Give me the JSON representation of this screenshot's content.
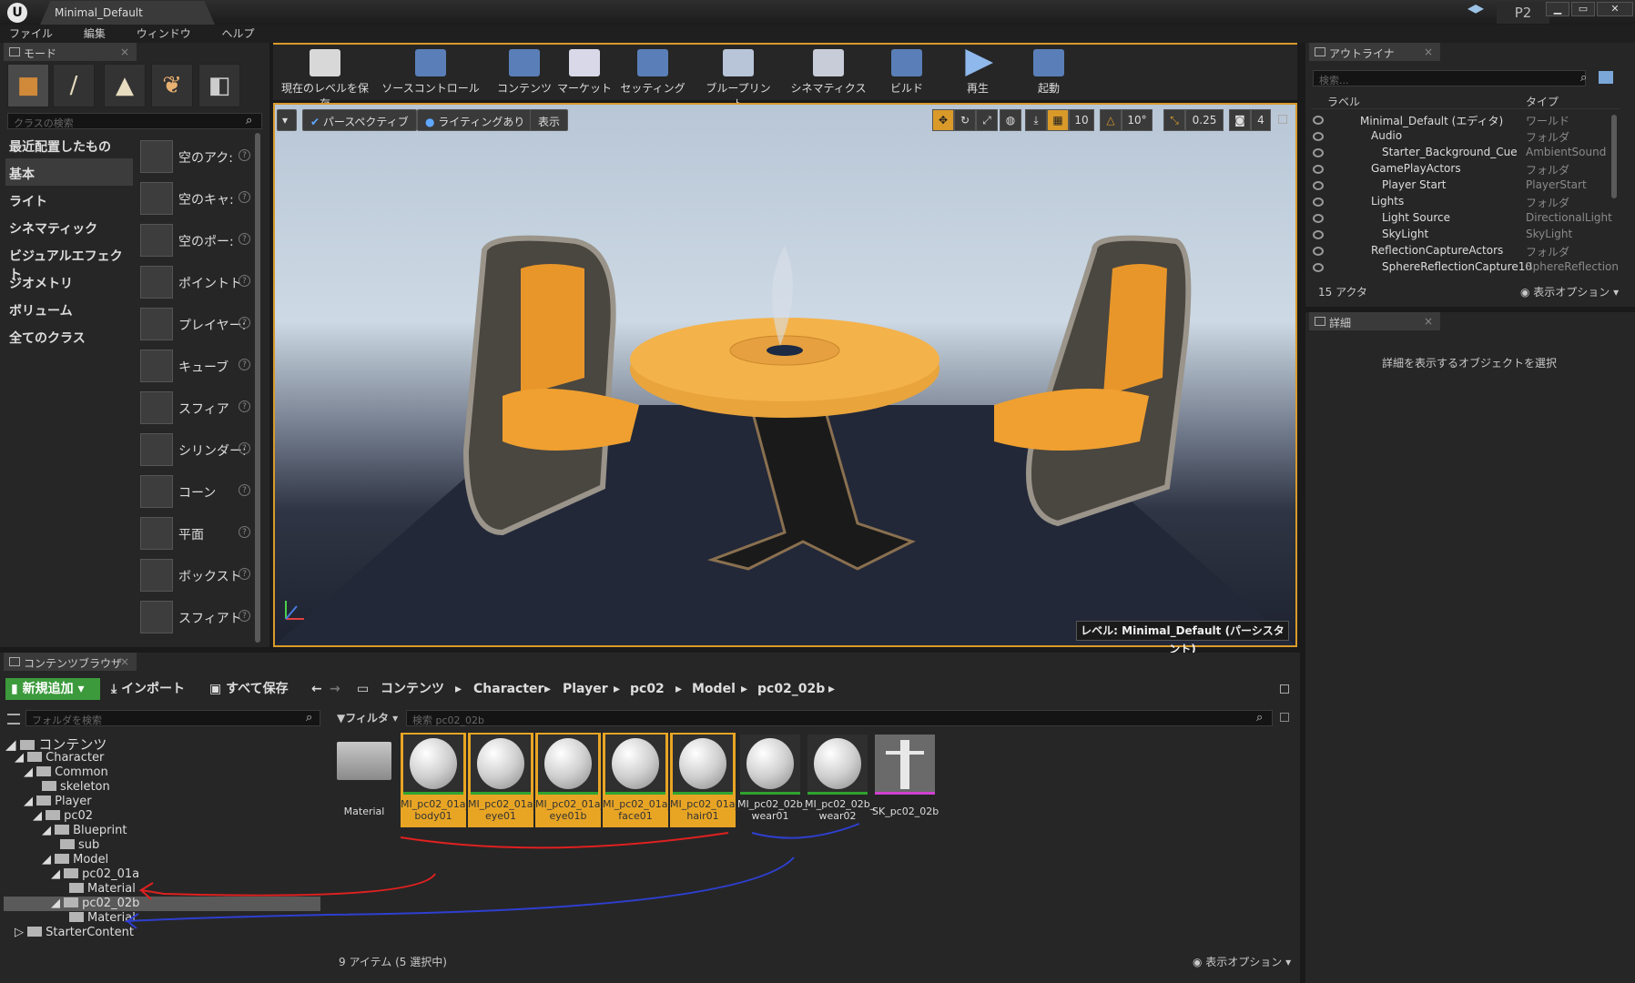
{
  "window": {
    "tab_title": "Minimal_Default",
    "p2": "P2",
    "controls": [
      "▁",
      "▭",
      "✕"
    ]
  },
  "menu": [
    "ファイル",
    "編集",
    "ウィンドウ",
    "ヘルプ"
  ],
  "modes": {
    "tab": "モード",
    "search_placeholder": "クラスの検索",
    "categories": [
      "最近配置したもの",
      "基本",
      "ライト",
      "シネマティック",
      "ビジュアルエフェクト",
      "ジオメトリ",
      "ボリューム",
      "全てのクラス"
    ],
    "selected_category": "基本",
    "items": [
      "空のアク:",
      "空のキャ:",
      "空のポー:",
      "ポイントト",
      "プレイヤー:",
      "キューブ",
      "スフィア",
      "シリンダー:",
      "コーン",
      "平面",
      "ボックスト",
      "スフィアト"
    ]
  },
  "toolbar": [
    "現在のレベルを保存",
    "ソースコントロール",
    "コンテンツ",
    "マーケット",
    "セッティング",
    "ブループリント",
    "シネマティクス",
    "ビルド",
    "再生",
    "起動"
  ],
  "viewport": {
    "perspective": "パースペクティブ",
    "lighting": "ライティングあり",
    "show": "表示",
    "grid_snap": "10",
    "rot_snap": "10°",
    "scale_snap": "0.25",
    "camera_speed": "4",
    "level_label": "レベル:  Minimal_Default (パーシスタント)"
  },
  "outliner": {
    "tab": "アウトライナ",
    "search_placeholder": "検索...",
    "col_label": "ラベル",
    "col_type": "タイプ",
    "rows": [
      {
        "name": "Minimal_Default (エディタ)",
        "type": "ワールド"
      },
      {
        "name": "Audio",
        "type": "フォルダ"
      },
      {
        "name": "Starter_Background_Cue",
        "type": "AmbientSound"
      },
      {
        "name": "GamePlayActors",
        "type": "フォルダ"
      },
      {
        "name": "Player Start",
        "type": "PlayerStart"
      },
      {
        "name": "Lights",
        "type": "フォルダ"
      },
      {
        "name": "Light Source",
        "type": "DirectionalLight"
      },
      {
        "name": "SkyLight",
        "type": "SkyLight"
      },
      {
        "name": "ReflectionCaptureActors",
        "type": "フォルダ"
      },
      {
        "name": "SphereReflectionCapture10",
        "type": "SphereReflection"
      }
    ],
    "actor_count": "15 アクタ",
    "view_options": "表示オプション"
  },
  "details": {
    "tab": "詳細",
    "empty_message": "詳細を表示するオブジェクトを選択"
  },
  "content_browser": {
    "tab": "コンテンツブラウザ",
    "add_new": "新規追加",
    "import": "インポート",
    "save_all": "すべて保存",
    "breadcrumb": [
      "コンテンツ",
      "Character",
      "Player",
      "pc02",
      "Model",
      "pc02_02b"
    ],
    "folder_search_placeholder": "フォルダを検索",
    "filter": "フィルタ",
    "asset_search_placeholder": "検索 pc02_02b",
    "tree": [
      "コンテンツ",
      "Character",
      "Common",
      "skeleton",
      "Player",
      "pc02",
      "Blueprint",
      "sub",
      "Model",
      "pc02_01a",
      "Material",
      "pc02_02b",
      "Material",
      "StarterContent"
    ],
    "assets": [
      {
        "line1": "Material",
        "line2": ""
      },
      {
        "line1": "MI_pc02_01a_",
        "line2": "body01"
      },
      {
        "line1": "MI_pc02_01a_",
        "line2": "eye01"
      },
      {
        "line1": "MI_pc02_01a_",
        "line2": "eye01b"
      },
      {
        "line1": "MI_pc02_01a_",
        "line2": "face01"
      },
      {
        "line1": "MI_pc02_01a_",
        "line2": "hair01"
      },
      {
        "line1": "MI_pc02_02b_",
        "line2": "wear01"
      },
      {
        "line1": "MI_pc02_02b_",
        "line2": "wear02"
      },
      {
        "line1": "SK_pc02_02b",
        "line2": ""
      }
    ],
    "item_count": "9 アイテム (5 選択中)",
    "view_options": "表示オプション"
  },
  "colors": {
    "accent_orange": "#e8a524",
    "add_green": "#3c9a3c",
    "annotation_red": "#e02020",
    "annotation_blue": "#2e3fd0"
  }
}
